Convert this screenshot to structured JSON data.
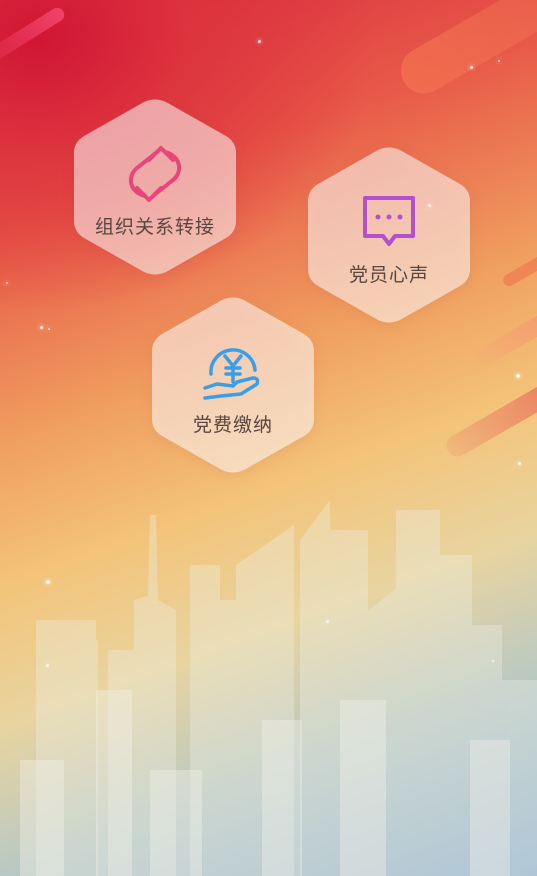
{
  "menu": {
    "items": [
      {
        "label": "组织关系转接",
        "icon": "transfer-arrows-icon",
        "color": "#e8457a"
      },
      {
        "label": "党员心声",
        "icon": "message-bubble-icon",
        "color": "#b44fd0"
      },
      {
        "label": "党费缴纳",
        "icon": "yuan-coin-hand-icon",
        "color": "#3b9ee8"
      }
    ]
  }
}
